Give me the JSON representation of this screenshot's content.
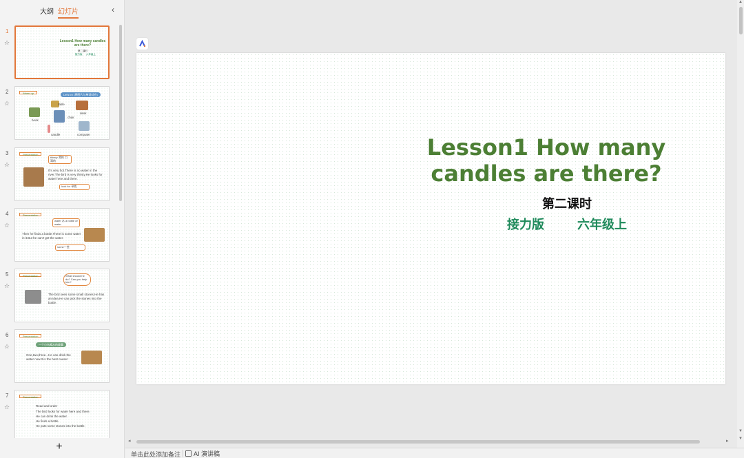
{
  "sidebar": {
    "tabs": {
      "outline": "大纲",
      "slides": "幻灯片"
    },
    "collapse_icon": "‹",
    "add_icon": "+",
    "thumbs": [
      {
        "num": "1",
        "title": "Lesson1 How many candles are there?",
        "sub": "第二课时",
        "pub": "接力版",
        "grade": "六年级上"
      },
      {
        "num": "2",
        "tag": "Warm up",
        "pill": "Let's try (将图片与单词对应)",
        "words": [
          "table",
          "book",
          "desk",
          "candle",
          "computer",
          "chair"
        ]
      },
      {
        "num": "3",
        "tag": "Presentation",
        "bubble1": "thirsty 渴的 口渴的",
        "text": "It's very hot.There is no water in the river.The bird is very thirsty.He looks for water here and there.",
        "bubble2": "look for 寻找"
      },
      {
        "num": "4",
        "tag": "Presentation",
        "bubble1": "water 水 a bottle of water",
        "text": "Then he finds a bottle.There is some water in it.But he can't get the water.",
        "bubble2": "some一些"
      },
      {
        "num": "5",
        "tag": "Presentation",
        "bubble1": "What should he do? Can you help him?",
        "text": "The bird sees some small stones.He has an idea.He can pick the stones into the bottle."
      },
      {
        "num": "6",
        "tag": "Presentation",
        "pill": "一个小鸟喝水的故事",
        "text": "One,two,three...He can drink the water now.It is the best cause!"
      },
      {
        "num": "7",
        "tag": "Presentation",
        "heading": "Read and order",
        "lines": [
          "The bird looks for water here and there.",
          "He can drink the water.",
          "He finds a bottle.",
          "He puts some stones into the bottle."
        ]
      }
    ]
  },
  "slide": {
    "title": "Lesson1 How many candles are there?",
    "subtitle": "第二课时",
    "publisher": "接力版",
    "grade": "六年级上"
  },
  "statusbar": {
    "notes_placeholder": "单击此处添加备注",
    "ai_label": "AI 演讲稿"
  },
  "colors": {
    "accent": "#e2773a",
    "title_green": "#4c7f34",
    "teal": "#1f8a5b"
  }
}
